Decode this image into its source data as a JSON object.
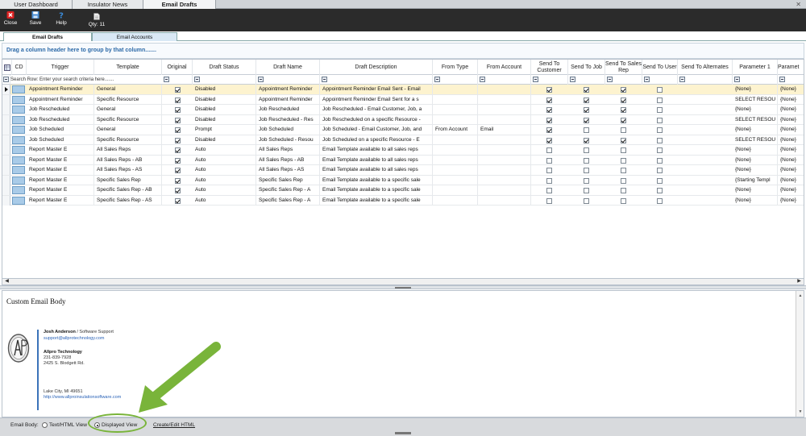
{
  "top_tabs": [
    {
      "label": "User Dashboard"
    },
    {
      "label": "Insulator News"
    },
    {
      "label": "Email Drafts"
    }
  ],
  "toolbar": {
    "close_label": "Close",
    "save_label": "Save",
    "help_label": "Help",
    "qty_label": "Qty: 11"
  },
  "sub_tabs": {
    "drafts": "Email Drafts",
    "accounts": "Email Accounts"
  },
  "group_bar_text": "Drag a column header here to group by that column.......",
  "grid": {
    "headers": {
      "cd": "CD",
      "trigger": "Trigger",
      "template": "Template",
      "original": "Original",
      "status": "Draft Status",
      "name": "Draft Name",
      "desc": "Draft Description",
      "from_type": "From Type",
      "from_account": "From Account",
      "send_customer": "Send To Customer",
      "send_job": "Send To Job",
      "send_rep": "Send To Sales Rep",
      "send_user": "Send To User",
      "send_alt": "Send To Alternates",
      "param1": "Parameter 1",
      "param2": "Paramet"
    },
    "search_placeholder": "Search Row: Enter your search criteria here.......",
    "rows": [
      {
        "trigger": "Appointment Reminder",
        "template": "General",
        "original": true,
        "status": "Disabled",
        "name": "Appointment Reminder",
        "desc": "Appointment Reminder Email Sent - Email",
        "from_type": "",
        "from_account": "",
        "customer": true,
        "job": true,
        "rep": true,
        "user": false,
        "param1": "{None}",
        "param2": "{None}"
      },
      {
        "trigger": "Appointment Reminder",
        "template": "Specific Resource",
        "original": true,
        "status": "Disabled",
        "name": "Appointment Reminder",
        "desc": "Appointment Reminder Email Sent for a s",
        "from_type": "",
        "from_account": "",
        "customer": true,
        "job": true,
        "rep": true,
        "user": false,
        "param1": "SELECT RESOU",
        "param2": "{None}"
      },
      {
        "trigger": "Job Rescheduled",
        "template": "General",
        "original": true,
        "status": "Disabled",
        "name": "Job Rescheduled",
        "desc": "Job Rescheduled - Email Customer, Job, a",
        "from_type": "",
        "from_account": "",
        "customer": true,
        "job": true,
        "rep": true,
        "user": false,
        "param1": "{None}",
        "param2": "{None}"
      },
      {
        "trigger": "Job Rescheduled",
        "template": "Specific Resource",
        "original": true,
        "status": "Disabled",
        "name": "Job Rescheduled - Res",
        "desc": "Job Rescheduled on a specific Resource -",
        "from_type": "",
        "from_account": "",
        "customer": true,
        "job": true,
        "rep": true,
        "user": false,
        "param1": "SELECT RESOU",
        "param2": "{None}"
      },
      {
        "trigger": "Job Scheduled",
        "template": "General",
        "original": true,
        "status": "Prompt",
        "name": "Job Scheduled",
        "desc": "Job Scheduled - Email Customer, Job, and",
        "from_type": "From Account",
        "from_account": "Email",
        "customer": true,
        "job": false,
        "rep": false,
        "user": false,
        "param1": "{None}",
        "param2": "{None}"
      },
      {
        "trigger": "Job Scheduled",
        "template": "Specific Resource",
        "original": true,
        "status": "Disabled",
        "name": "Job Scheduled - Resou",
        "desc": "Job Scheduled on a specific Resource - E",
        "from_type": "",
        "from_account": "",
        "customer": true,
        "job": true,
        "rep": true,
        "user": false,
        "param1": "SELECT RESOU",
        "param2": "{None}"
      },
      {
        "trigger": "Report Master E",
        "template": "All Sales Reps",
        "original": true,
        "status": "Auto",
        "name": "All Sales Reps",
        "desc": "Email Template available to all sales reps",
        "from_type": "",
        "from_account": "",
        "customer": false,
        "job": false,
        "rep": false,
        "user": false,
        "param1": "{None}",
        "param2": "{None}"
      },
      {
        "trigger": "Report Master E",
        "template": "All Sales Reps - AB",
        "original": true,
        "status": "Auto",
        "name": "All Sales Reps - AB",
        "desc": "Email Template available to all sales reps",
        "from_type": "",
        "from_account": "",
        "customer": false,
        "job": false,
        "rep": false,
        "user": false,
        "param1": "{None}",
        "param2": "{None}"
      },
      {
        "trigger": "Report Master E",
        "template": "All Sales Reps - AS",
        "original": true,
        "status": "Auto",
        "name": "All Sales Reps - AS",
        "desc": "Email Template available to all sales reps",
        "from_type": "",
        "from_account": "",
        "customer": false,
        "job": false,
        "rep": false,
        "user": false,
        "param1": "{None}",
        "param2": "{None}"
      },
      {
        "trigger": "Report Master E",
        "template": "Specific Sales Rep",
        "original": true,
        "status": "Auto",
        "name": "Specific Sales Rep",
        "desc": "Email Template available to a specific sale",
        "from_type": "",
        "from_account": "",
        "customer": false,
        "job": false,
        "rep": false,
        "user": false,
        "param1": "{Starting Templ",
        "param2": "{None}"
      },
      {
        "trigger": "Report Master E",
        "template": "Specific Sales Rep - AB",
        "original": true,
        "status": "Auto",
        "name": "Specific Sales Rep - A",
        "desc": "Email Template available to a specific sale",
        "from_type": "",
        "from_account": "",
        "customer": false,
        "job": false,
        "rep": false,
        "user": false,
        "param1": "{None}",
        "param2": "{None}"
      },
      {
        "trigger": "Report Master E",
        "template": "Specific Sales Rep - AS",
        "original": true,
        "status": "Auto",
        "name": "Specific Sales Rep - A",
        "desc": "Email Template available to a specific sale",
        "from_type": "",
        "from_account": "",
        "customer": false,
        "job": false,
        "rep": false,
        "user": false,
        "param1": "{None}",
        "param2": "{None}"
      }
    ]
  },
  "email_body": {
    "title": "Custom Email Body",
    "signature": {
      "name": "Josh Anderson",
      "role": " / Software Support",
      "email": "support@allprotechnology.com",
      "company": "Allpro Technology",
      "phone": "231-839-7928",
      "address": "2425 S. Blodgett Rd.",
      "city": "Lake City, MI 49651",
      "website": "http://www.allproinsulationsoftware.com"
    }
  },
  "bottom_bar": {
    "label": "Email Body:",
    "option_text": "Text/HTML View",
    "option_display": "Displayed View",
    "create_link": "Create/Edit HTML"
  },
  "colors": {
    "annotation_arrow": "#79b43a",
    "group_text": "#2d6aa8",
    "selected_row": "#fdf3cf"
  }
}
